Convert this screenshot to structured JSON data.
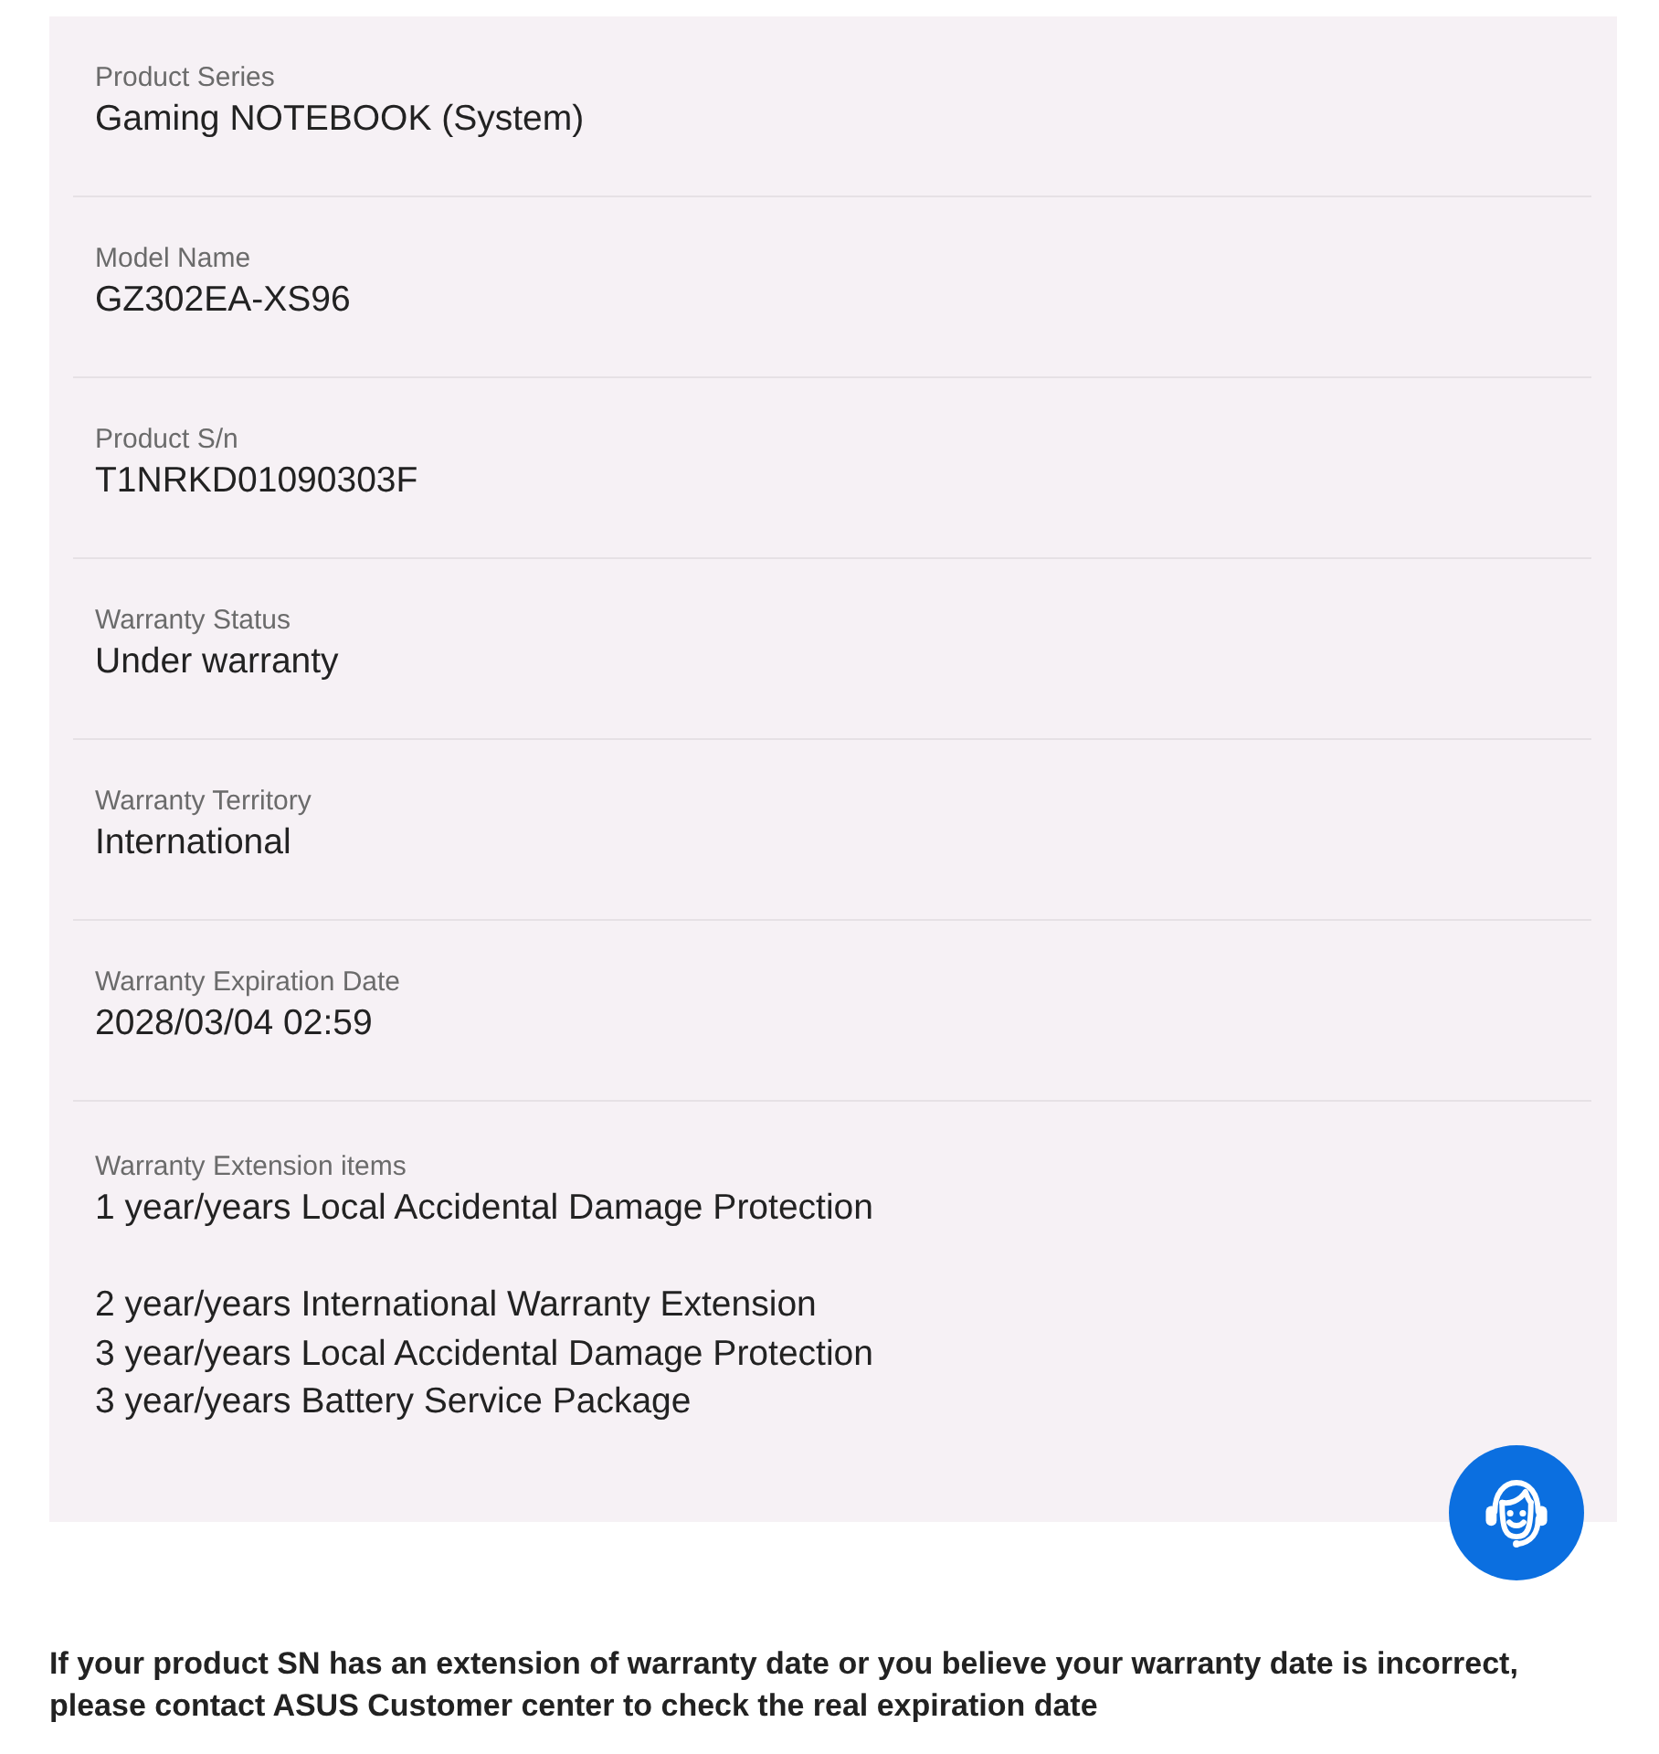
{
  "details": [
    {
      "kind": "single",
      "label": "Product Series",
      "value": "Gaming NOTEBOOK (System)"
    },
    {
      "kind": "single",
      "label": "Model Name",
      "value": "GZ302EA-XS96"
    },
    {
      "kind": "single",
      "label": "Product S/n",
      "value": "T1NRKD01090303F"
    },
    {
      "kind": "single",
      "label": "Warranty Status",
      "value": "Under warranty"
    },
    {
      "kind": "single",
      "label": "Warranty Territory",
      "value": "International"
    },
    {
      "kind": "single",
      "label": "Warranty Expiration Date",
      "value": "2028/03/04 02:59"
    },
    {
      "kind": "multi",
      "label": "Warranty Extension items",
      "value_groups": [
        [
          "1 year/years Local Accidental Damage Protection"
        ],
        [
          "2 year/years International Warranty Extension",
          "3 year/years Local Accidental Damage Protection",
          "3 year/years Battery Service Package"
        ]
      ]
    }
  ],
  "notice": "If your product SN has an extension of warranty date or you believe your warranty date is incorrect, please contact ASUS Customer center to check the real expiration date"
}
